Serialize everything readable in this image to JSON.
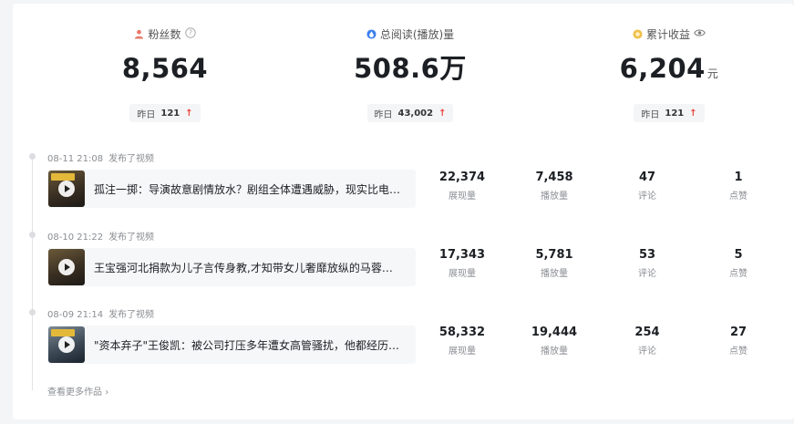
{
  "stats": [
    {
      "label": "粉丝数",
      "icon": "person-icon",
      "value": "8,564",
      "unit": "",
      "yday_label": "昨日",
      "yday_value": "121",
      "trend": "up"
    },
    {
      "label": "总阅读(播放)量",
      "icon": "droplet-icon",
      "value": "508.6万",
      "unit": "",
      "yday_label": "昨日",
      "yday_value": "43,002",
      "trend": "up"
    },
    {
      "label": "累计收益",
      "icon": "coin-icon",
      "value": "6,204",
      "unit": "元",
      "yday_label": "昨日",
      "yday_value": "121",
      "trend": "up"
    }
  ],
  "up_arrow": "↑",
  "works": [
    {
      "date": "08-11 21:08",
      "action": "发布了视频",
      "title": "孤注一掷：导演故意剧情放水？剧组全体遭遇威胁，现实比电…",
      "metrics": [
        {
          "value": "22,374",
          "label": "展现量"
        },
        {
          "value": "7,458",
          "label": "播放量"
        },
        {
          "value": "47",
          "label": "评论"
        },
        {
          "value": "1",
          "label": "点赞"
        }
      ]
    },
    {
      "date": "08-10 21:22",
      "action": "发布了视频",
      "title": "王宝强河北捐款为儿子言传身教,才知带女儿奢靡放纵的马蓉多…",
      "metrics": [
        {
          "value": "17,343",
          "label": "展现量"
        },
        {
          "value": "5,781",
          "label": "播放量"
        },
        {
          "value": "53",
          "label": "评论"
        },
        {
          "value": "5",
          "label": "点赞"
        }
      ]
    },
    {
      "date": "08-09 21:14",
      "action": "发布了视频",
      "title": "\"资本弃子\"王俊凯：被公司打压多年遭女高管骚扰，他都经历…",
      "metrics": [
        {
          "value": "58,332",
          "label": "展现量"
        },
        {
          "value": "19,444",
          "label": "播放量"
        },
        {
          "value": "254",
          "label": "评论"
        },
        {
          "value": "27",
          "label": "点赞"
        }
      ]
    }
  ],
  "more_link": "查看更多作品",
  "colors": {
    "accent_red": "#e8453c",
    "person": "#e8796a",
    "droplet": "#3b7ff0",
    "coin": "#f0c04a"
  }
}
